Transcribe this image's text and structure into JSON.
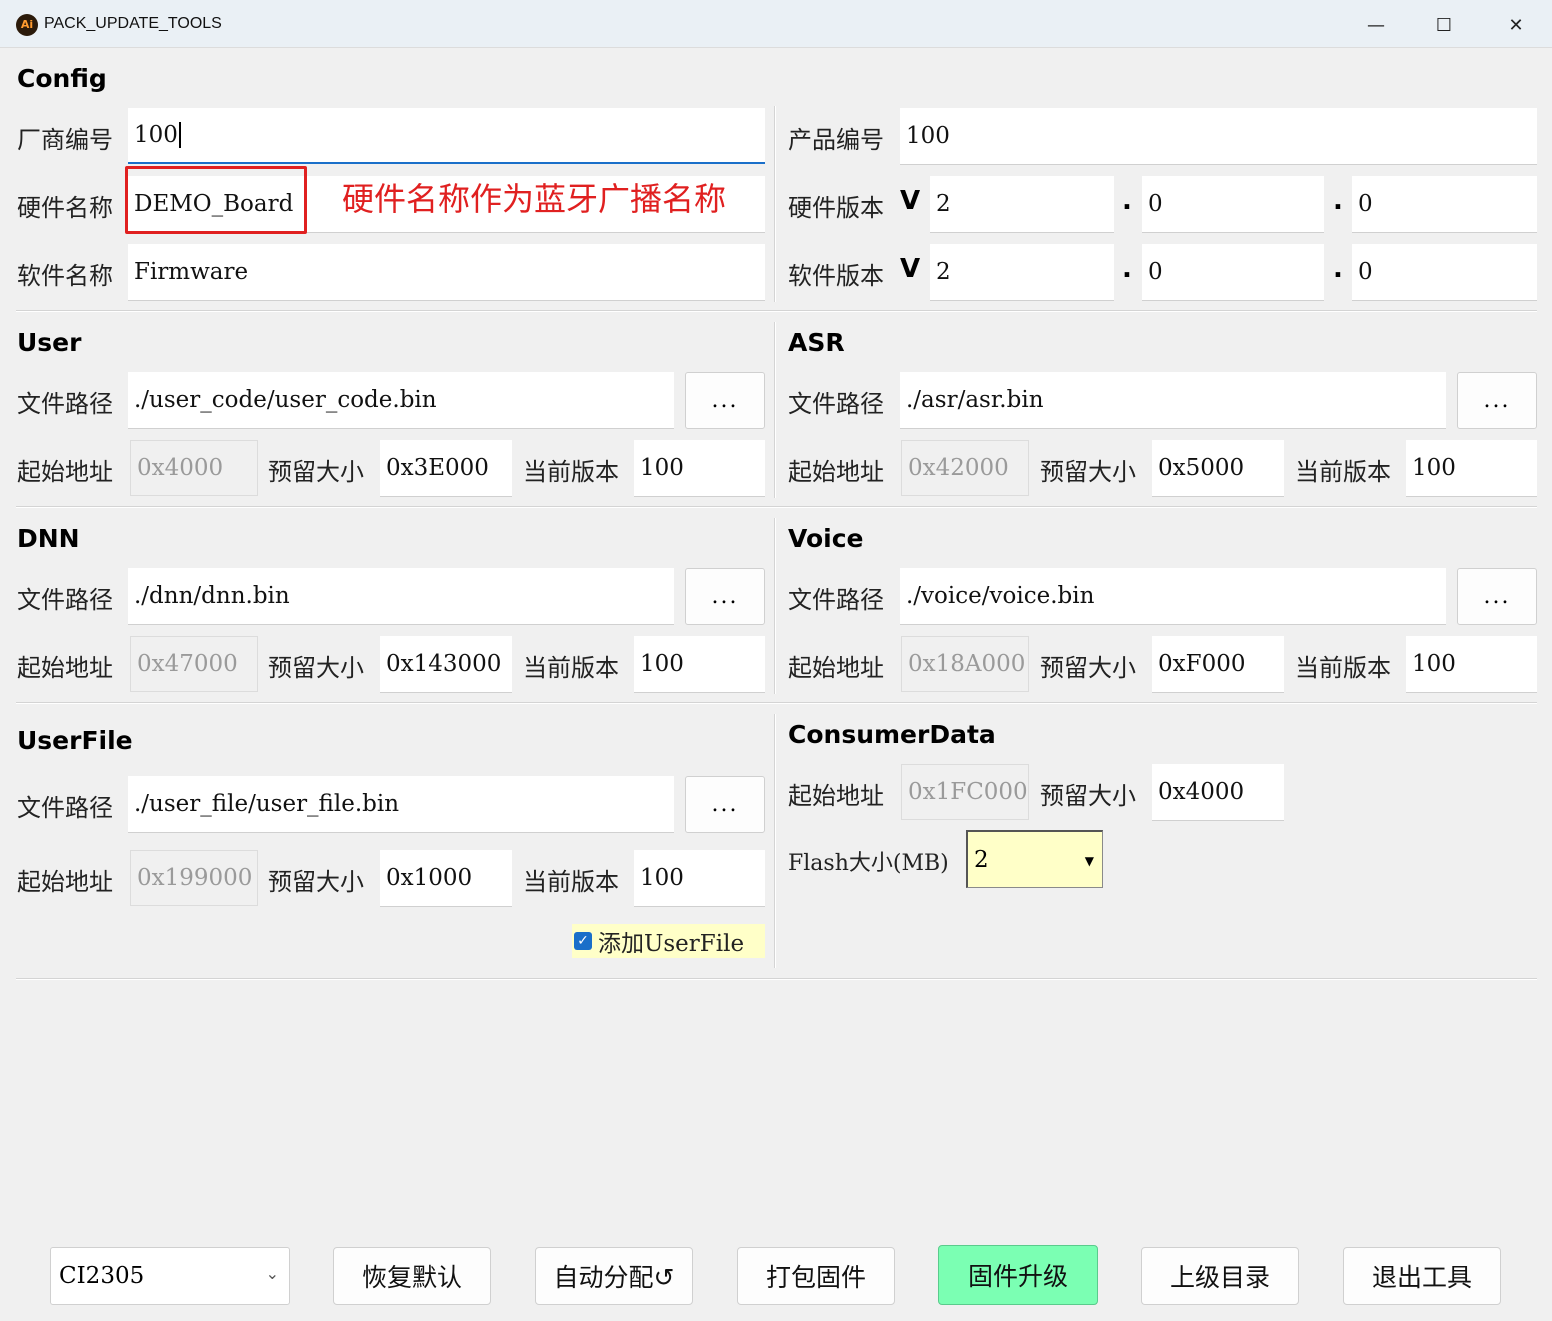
{
  "window": {
    "title": "PACK_UPDATE_TOOLS",
    "app_icon_text": "Ai",
    "minimize": "—",
    "maximize": "☐",
    "close": "✕"
  },
  "config": {
    "heading": "Config",
    "vendor_label": "厂商编号",
    "vendor_value": "100",
    "hw_name_label": "硬件名称",
    "hw_name_value": "DEMO_Board",
    "sw_name_label": "软件名称",
    "sw_name_value": "Firmware",
    "product_label": "产品编号",
    "product_value": "100",
    "hw_version_label": "硬件版本",
    "sw_version_label": "软件版本",
    "v_mark": "V",
    "dot": ".",
    "hw_version": [
      "2",
      "0",
      "0"
    ],
    "sw_version": [
      "2",
      "0",
      "0"
    ],
    "annotation": "硬件名称作为蓝牙广播名称"
  },
  "labels": {
    "path": "文件路径",
    "start": "起始地址",
    "reserve": "预留大小",
    "version": "当前版本",
    "browse": "..."
  },
  "user": {
    "heading": "User",
    "path": "./user_code/user_code.bin",
    "start": "0x4000",
    "reserve": "0x3E000",
    "version": "100"
  },
  "asr": {
    "heading": "ASR",
    "path": "./asr/asr.bin",
    "start": "0x42000",
    "reserve": "0x5000",
    "version": "100"
  },
  "dnn": {
    "heading": "DNN",
    "path": "./dnn/dnn.bin",
    "start": "0x47000",
    "reserve": "0x143000",
    "version": "100"
  },
  "voice": {
    "heading": "Voice",
    "path": "./voice/voice.bin",
    "start": "0x18A000",
    "reserve": "0xF000",
    "version": "100"
  },
  "userfile": {
    "heading": "UserFile",
    "path": "./user_file/user_file.bin",
    "start": "0x199000",
    "reserve": "0x1000",
    "version": "100",
    "add_label": "添加UserFile",
    "add_checked": true
  },
  "consumer": {
    "heading": "ConsumerData",
    "start": "0x1FC000",
    "reserve": "0x4000",
    "flash_label": "Flash大小(MB)",
    "flash_value": "2"
  },
  "bottom": {
    "chip": "CI2305",
    "restore": "恢复默认",
    "auto": "自动分配↺",
    "pack": "打包固件",
    "upgrade": "固件升级",
    "parent": "上级目录",
    "exit": "退出工具"
  },
  "colors": {
    "accent": "#1a6fc9",
    "annotation": "#e02020",
    "upgrade_bg": "#7bffb3",
    "highlight": "#ffffc8"
  }
}
